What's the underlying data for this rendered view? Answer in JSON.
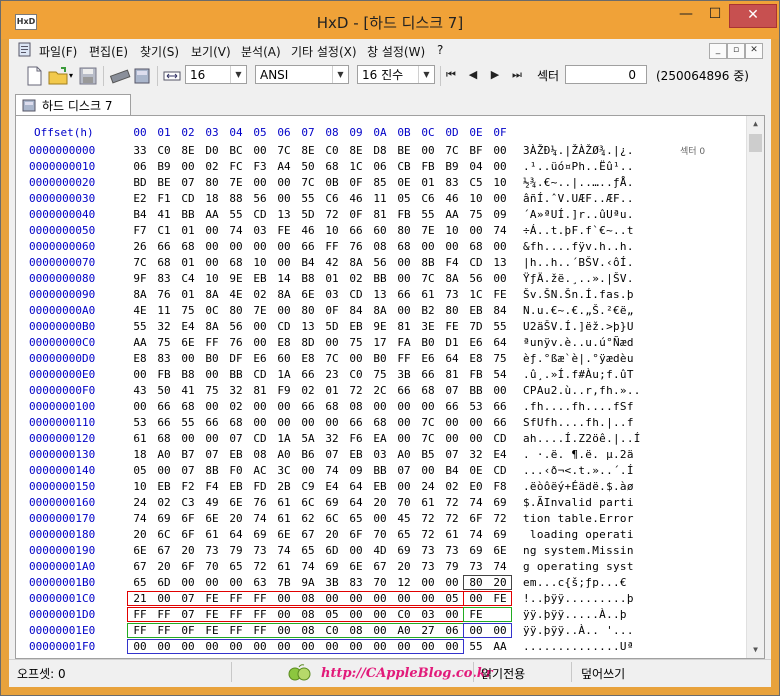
{
  "window": {
    "title": "HxD - [하드 디스크 7]",
    "controls": {
      "minimize": "—",
      "maximize": "☐",
      "close": "✕"
    },
    "app_icon_text": "HxD"
  },
  "menu": {
    "items": [
      "파일(F)",
      "편집(E)",
      "찾기(S)",
      "보기(V)",
      "분석(A)",
      "기타 설정(X)",
      "창 설정(W)",
      "?"
    ],
    "mdi_controls": [
      "_",
      "▫",
      "✕"
    ]
  },
  "toolbar": {
    "bytes_per_row": "16",
    "charset": "ANSI",
    "base": "16 진수",
    "nav": [
      "◀◀",
      "◀",
      "▶",
      "▶▶"
    ],
    "sector_label": "섹터",
    "sector_value": "0",
    "sector_total": "(250064896 중)"
  },
  "tab": {
    "label": "하드 디스크 7"
  },
  "editor": {
    "offset_header": "Offset(h)",
    "columns": [
      "00",
      "01",
      "02",
      "03",
      "04",
      "05",
      "06",
      "07",
      "08",
      "09",
      "0A",
      "0B",
      "0C",
      "0D",
      "0E",
      "0F"
    ],
    "sector_annotation": "섹터  0",
    "rows": [
      {
        "off": "0000000000",
        "hex": [
          "33",
          "C0",
          "8E",
          "D0",
          "BC",
          "00",
          "7C",
          "8E",
          "C0",
          "8E",
          "D8",
          "BE",
          "00",
          "7C",
          "BF",
          "00"
        ],
        "ascii": "3ÀŽÐ¼.|ŽÀŽØ¾.|¿."
      },
      {
        "off": "0000000010",
        "hex": [
          "06",
          "B9",
          "00",
          "02",
          "FC",
          "F3",
          "A4",
          "50",
          "68",
          "1C",
          "06",
          "CB",
          "FB",
          "B9",
          "04",
          "00"
        ],
        "ascii": ".¹..üó¤Ph..Ëû¹.."
      },
      {
        "off": "0000000020",
        "hex": [
          "BD",
          "BE",
          "07",
          "80",
          "7E",
          "00",
          "00",
          "7C",
          "0B",
          "0F",
          "85",
          "0E",
          "01",
          "83",
          "C5",
          "10"
        ],
        "ascii": "½¾.€~..|..…..ƒÅ."
      },
      {
        "off": "0000000030",
        "hex": [
          "E2",
          "F1",
          "CD",
          "18",
          "88",
          "56",
          "00",
          "55",
          "C6",
          "46",
          "11",
          "05",
          "C6",
          "46",
          "10",
          "00"
        ],
        "ascii": "âñÍ.ˆV.UÆF..ÆF.."
      },
      {
        "off": "0000000040",
        "hex": [
          "B4",
          "41",
          "BB",
          "AA",
          "55",
          "CD",
          "13",
          "5D",
          "72",
          "0F",
          "81",
          "FB",
          "55",
          "AA",
          "75",
          "09"
        ],
        "ascii": "´A»ªUÍ.]r..ûUªu."
      },
      {
        "off": "0000000050",
        "hex": [
          "F7",
          "C1",
          "01",
          "00",
          "74",
          "03",
          "FE",
          "46",
          "10",
          "66",
          "60",
          "80",
          "7E",
          "10",
          "00",
          "74"
        ],
        "ascii": "÷Á..t.þF.f`€~..t"
      },
      {
        "off": "0000000060",
        "hex": [
          "26",
          "66",
          "68",
          "00",
          "00",
          "00",
          "00",
          "66",
          "FF",
          "76",
          "08",
          "68",
          "00",
          "00",
          "68",
          "00"
        ],
        "ascii": "&fh....fÿv.h..h."
      },
      {
        "off": "0000000070",
        "hex": [
          "7C",
          "68",
          "01",
          "00",
          "68",
          "10",
          "00",
          "B4",
          "42",
          "8A",
          "56",
          "00",
          "8B",
          "F4",
          "CD",
          "13"
        ],
        "ascii": "|h..h..´BŠV.‹ôÍ."
      },
      {
        "off": "0000000080",
        "hex": [
          "9F",
          "83",
          "C4",
          "10",
          "9E",
          "EB",
          "14",
          "B8",
          "01",
          "02",
          "BB",
          "00",
          "7C",
          "8A",
          "56",
          "00"
        ],
        "ascii": "ŸƒÄ.žë.¸..».|ŠV."
      },
      {
        "off": "0000000090",
        "hex": [
          "8A",
          "76",
          "01",
          "8A",
          "4E",
          "02",
          "8A",
          "6E",
          "03",
          "CD",
          "13",
          "66",
          "61",
          "73",
          "1C",
          "FE"
        ],
        "ascii": "Šv.ŠN.Šn.Í.fas.þ"
      },
      {
        "off": "00000000A0",
        "hex": [
          "4E",
          "11",
          "75",
          "0C",
          "80",
          "7E",
          "00",
          "80",
          "0F",
          "84",
          "8A",
          "00",
          "B2",
          "80",
          "EB",
          "84"
        ],
        "ascii": "N.u.€~.€.„Š.²€ë„"
      },
      {
        "off": "00000000B0",
        "hex": [
          "55",
          "32",
          "E4",
          "8A",
          "56",
          "00",
          "CD",
          "13",
          "5D",
          "EB",
          "9E",
          "81",
          "3E",
          "FE",
          "7D",
          "55"
        ],
        "ascii": "U2äŠV.Í.]ëž.>þ}U"
      },
      {
        "off": "00000000C0",
        "hex": [
          "AA",
          "75",
          "6E",
          "FF",
          "76",
          "00",
          "E8",
          "8D",
          "00",
          "75",
          "17",
          "FA",
          "B0",
          "D1",
          "E6",
          "64"
        ],
        "ascii": "ªunÿv.è..u.ú°Ñæd"
      },
      {
        "off": "00000000D0",
        "hex": [
          "E8",
          "83",
          "00",
          "B0",
          "DF",
          "E6",
          "60",
          "E8",
          "7C",
          "00",
          "B0",
          "FF",
          "E6",
          "64",
          "E8",
          "75"
        ],
        "ascii": "èƒ.°ßæ`è|.°ÿædèu"
      },
      {
        "off": "00000000E0",
        "hex": [
          "00",
          "FB",
          "B8",
          "00",
          "BB",
          "CD",
          "1A",
          "66",
          "23",
          "C0",
          "75",
          "3B",
          "66",
          "81",
          "FB",
          "54"
        ],
        "ascii": ".û¸.»Í.f#Àu;f.ûT"
      },
      {
        "off": "00000000F0",
        "hex": [
          "43",
          "50",
          "41",
          "75",
          "32",
          "81",
          "F9",
          "02",
          "01",
          "72",
          "2C",
          "66",
          "68",
          "07",
          "BB",
          "00"
        ],
        "ascii": "CPAu2.ù..r,fh.».."
      },
      {
        "off": "0000000100",
        "hex": [
          "00",
          "66",
          "68",
          "00",
          "02",
          "00",
          "00",
          "66",
          "68",
          "08",
          "00",
          "00",
          "00",
          "66",
          "53",
          "66"
        ],
        "ascii": ".fh....fh....fSf"
      },
      {
        "off": "0000000110",
        "hex": [
          "53",
          "66",
          "55",
          "66",
          "68",
          "00",
          "00",
          "00",
          "00",
          "66",
          "68",
          "00",
          "7C",
          "00",
          "00",
          "66"
        ],
        "ascii": "SfUfh....fh.|..f"
      },
      {
        "off": "0000000120",
        "hex": [
          "61",
          "68",
          "00",
          "00",
          "07",
          "CD",
          "1A",
          "5A",
          "32",
          "F6",
          "EA",
          "00",
          "7C",
          "00",
          "00",
          "CD"
        ],
        "ascii": "ah....Í.Z2öê.|..Í"
      },
      {
        "off": "0000000130",
        "hex": [
          "18",
          "A0",
          "B7",
          "07",
          "EB",
          "08",
          "A0",
          "B6",
          "07",
          "EB",
          "03",
          "A0",
          "B5",
          "07",
          "32",
          "E4"
        ],
        "ascii": ". ·.ë. ¶.ë. µ.2ä"
      },
      {
        "off": "0000000140",
        "hex": [
          "05",
          "00",
          "07",
          "8B",
          "F0",
          "AC",
          "3C",
          "00",
          "74",
          "09",
          "BB",
          "07",
          "00",
          "B4",
          "0E",
          "CD"
        ],
        "ascii": "...‹ð¬<.t.»..´.Í"
      },
      {
        "off": "0000000150",
        "hex": [
          "10",
          "EB",
          "F2",
          "F4",
          "EB",
          "FD",
          "2B",
          "C9",
          "E4",
          "64",
          "EB",
          "00",
          "24",
          "02",
          "E0",
          "F8"
        ],
        "ascii": ".ëòôëý+Éädë.$.àø"
      },
      {
        "off": "0000000160",
        "hex": [
          "24",
          "02",
          "C3",
          "49",
          "6E",
          "76",
          "61",
          "6C",
          "69",
          "64",
          "20",
          "70",
          "61",
          "72",
          "74",
          "69"
        ],
        "ascii": "$.ÃInvalid parti"
      },
      {
        "off": "0000000170",
        "hex": [
          "74",
          "69",
          "6F",
          "6E",
          "20",
          "74",
          "61",
          "62",
          "6C",
          "65",
          "00",
          "45",
          "72",
          "72",
          "6F",
          "72"
        ],
        "ascii": "tion table.Error"
      },
      {
        "off": "0000000180",
        "hex": [
          "20",
          "6C",
          "6F",
          "61",
          "64",
          "69",
          "6E",
          "67",
          "20",
          "6F",
          "70",
          "65",
          "72",
          "61",
          "74",
          "69"
        ],
        "ascii": " loading operati"
      },
      {
        "off": "0000000190",
        "hex": [
          "6E",
          "67",
          "20",
          "73",
          "79",
          "73",
          "74",
          "65",
          "6D",
          "00",
          "4D",
          "69",
          "73",
          "73",
          "69",
          "6E"
        ],
        "ascii": "ng system.Missin"
      },
      {
        "off": "00000001A0",
        "hex": [
          "67",
          "20",
          "6F",
          "70",
          "65",
          "72",
          "61",
          "74",
          "69",
          "6E",
          "67",
          "20",
          "73",
          "79",
          "73",
          "74"
        ],
        "ascii": "g operating syst"
      },
      {
        "off": "00000001B0",
        "hex": [
          "65",
          "6D",
          "00",
          "00",
          "00",
          "63",
          "7B",
          "9A",
          "3B",
          "83",
          "70",
          "12",
          "00",
          "00",
          "80",
          "20"
        ],
        "ascii": "em...c{š;ƒp...€ "
      },
      {
        "off": "00000001C0",
        "hex": [
          "21",
          "00",
          "07",
          "FE",
          "FF",
          "FF",
          "00",
          "08",
          "00",
          "00",
          "00",
          "00",
          "00",
          "05",
          "00",
          "FE"
        ],
        "ascii": "!..þÿÿ.........þ"
      },
      {
        "off": "00000001D0",
        "hex": [
          "FF",
          "FF",
          "07",
          "FE",
          "FF",
          "FF",
          "00",
          "08",
          "05",
          "00",
          "00",
          "C0",
          "03",
          "00",
          "FE"
        ],
        "ascii": "ÿÿ.þÿÿ.....À..þ"
      },
      {
        "off": "00000001E0",
        "hex": [
          "FF",
          "FF",
          "0F",
          "FE",
          "FF",
          "FF",
          "00",
          "08",
          "C0",
          "08",
          "00",
          "A0",
          "27",
          "06",
          "00",
          "00"
        ],
        "ascii": "ÿÿ.þÿÿ..À.. '..."
      },
      {
        "off": "00000001F0",
        "hex": [
          "00",
          "00",
          "00",
          "00",
          "00",
          "00",
          "00",
          "00",
          "00",
          "00",
          "00",
          "00",
          "00",
          "00",
          "55",
          "AA"
        ],
        "ascii": "..............Uª"
      }
    ]
  },
  "highlight_colors": {
    "partition1": "#e00000",
    "partition2": "#e00000",
    "partition3": "#22aa22",
    "partition4": "#3333cc",
    "bootcode_end": "#444444"
  },
  "status": {
    "offset": "오프셋: 0",
    "mode": "읽기전용",
    "write_mode": "덮어쓰기",
    "watermark": "http://CAppleBlog.co.kr"
  }
}
